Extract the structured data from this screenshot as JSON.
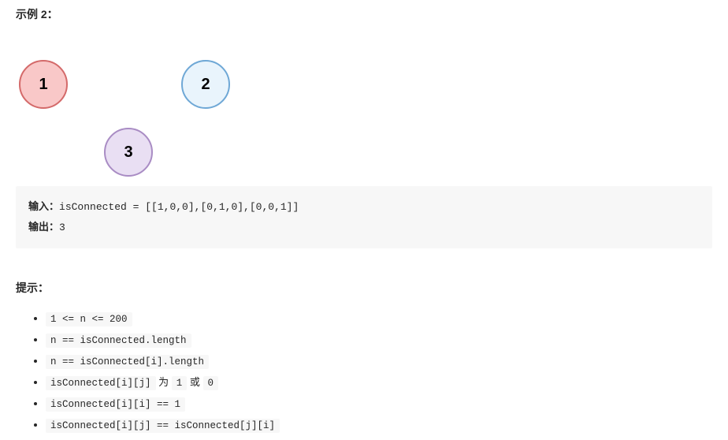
{
  "example": {
    "heading": "示例 2：",
    "nodes": {
      "n1": "1",
      "n2": "2",
      "n3": "3"
    },
    "io": {
      "input_label": "输入：",
      "input_value": "isConnected = [[1,0,0],[0,1,0],[0,0,1]]",
      "output_label": "输出：",
      "output_value": "3"
    }
  },
  "tips": {
    "heading": "提示：",
    "items": [
      {
        "code": "1 <= n <= 200"
      },
      {
        "code": "n == isConnected.length"
      },
      {
        "code": "n == isConnected[i].length"
      },
      {
        "code_pre": "isConnected[i][j]",
        "mid": " 为 ",
        "code_a": "1",
        "mid2": " 或 ",
        "code_b": "0"
      },
      {
        "code": "isConnected[i][i] == 1"
      },
      {
        "code": "isConnected[i][j] == isConnected[j][i]"
      }
    ]
  }
}
